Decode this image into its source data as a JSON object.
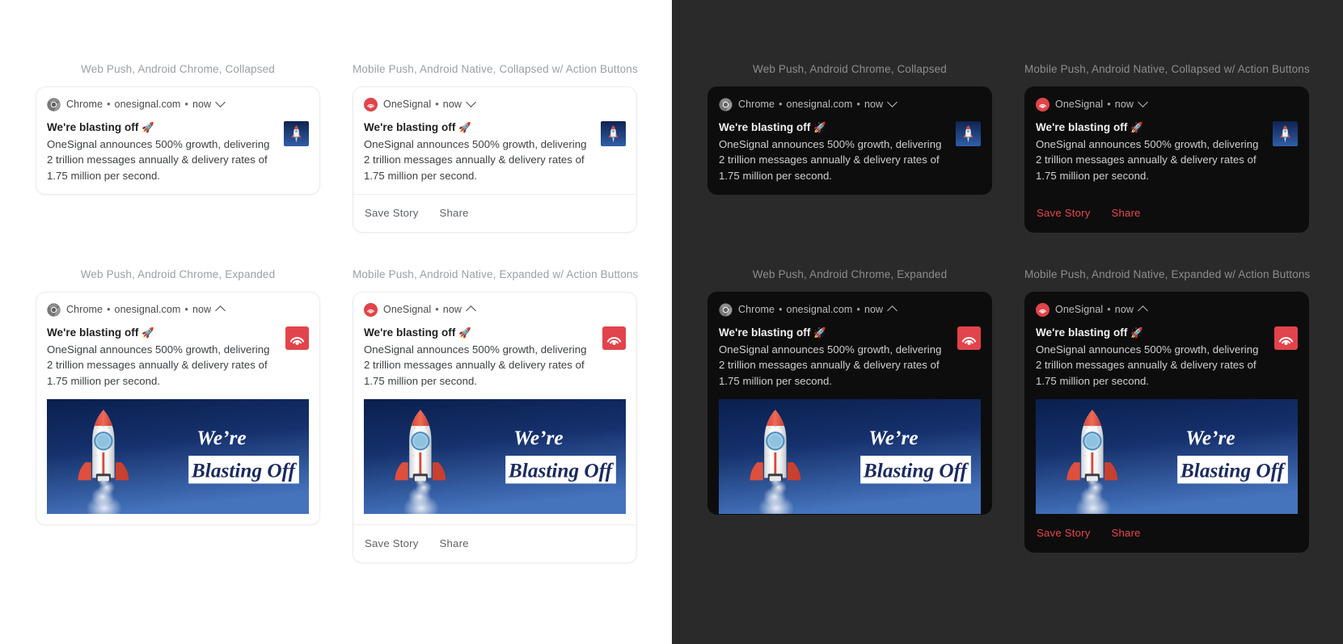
{
  "theme": {
    "light_bg": "#ffffff",
    "dark_bg": "#2a2a2a",
    "dark_card_bg": "#0d0d0d",
    "light_card_bg": "#ffffff",
    "accent_red": "#e5484d",
    "onesignal_red": "#e1444a",
    "label_light": "#9aa0a6",
    "label_dark": "#8b8d8f",
    "action_light": "#5f6368"
  },
  "notification": {
    "title": "We're blasting off",
    "title_emoji": "🚀",
    "message": "OneSignal announces 500% growth, delivering 2 trillion messages annually & delivery rates of 1.75 million per second.",
    "timestamp": "now",
    "web_source": {
      "app": "Chrome",
      "domain": "onesignal.com",
      "icon": "chrome-icon"
    },
    "mobile_source": {
      "app": "OneSignal",
      "icon": "onesignal-icon"
    },
    "separator": "•",
    "actions": [
      "Save Story",
      "Share"
    ],
    "hero": {
      "headline_line1": "We're",
      "headline_line2": "Blasting Off",
      "alt": "rocket-launch-image"
    }
  },
  "previews": {
    "light": [
      {
        "label": "Web Push, Android Chrome, Collapsed"
      },
      {
        "label": "Mobile Push, Android Native, Collapsed w/ Action Buttons"
      },
      {
        "label": "Web Push, Android Chrome, Expanded"
      },
      {
        "label": "Mobile Push, Android Native, Expanded w/ Action Buttons"
      }
    ],
    "dark": [
      {
        "label": "Web Push, Android Chrome, Collapsed"
      },
      {
        "label": "Mobile Push, Android Native, Collapsed w/ Action Buttons"
      },
      {
        "label": "Web Push, Android Chrome, Expanded"
      },
      {
        "label": "Mobile Push, Android Native, Expanded w/ Action Buttons"
      }
    ]
  }
}
